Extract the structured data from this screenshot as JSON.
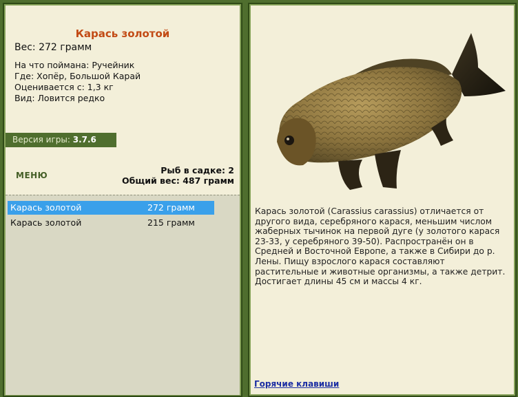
{
  "fish": {
    "title": "Карась золотой",
    "weight_line": "Вес: 272 грамм",
    "bait_line": "На что поймана: Ручейник",
    "location_line": "Где: Хопёр, Большой Карай",
    "value_line": "Оценивается с: 1,3 кг",
    "rarity_line": "Вид: Ловится редко",
    "description": "Карась золотой (Carassius carassius) отличается от другого вида, серебряного карася, меньшим числом жаберных тычинок на первой дуге (у золотого карася 23-33, у серебряного 39-50). Распространён он в Средней и Восточной Европе, а также в Сибири до р. Лены. Пищу взрослого карася составляют растительные и животные организмы, а также детрит. Достигает длины 45 см и массы 4 кг."
  },
  "version": {
    "label": "Версия игры:",
    "value": "3.7.6"
  },
  "menu": {
    "label": "МЕНЮ"
  },
  "stats": {
    "count_line": "Рыб в садке: 2",
    "total_line": "Общий вес: 487 грамм"
  },
  "catch_list": [
    {
      "name": "Карась золотой",
      "weight": "272 грамм",
      "selected": true
    },
    {
      "name": "Карась золотой",
      "weight": "215 грамм",
      "selected": false
    }
  ],
  "hotkeys": {
    "label": "Горячие клавиши"
  },
  "colors": {
    "panel_bg": "#f3efd9",
    "frame_green": "#4f6e2e",
    "title_orange": "#c24a14",
    "selection_blue": "#3aa0ea",
    "link_blue": "#1c2ea3"
  }
}
